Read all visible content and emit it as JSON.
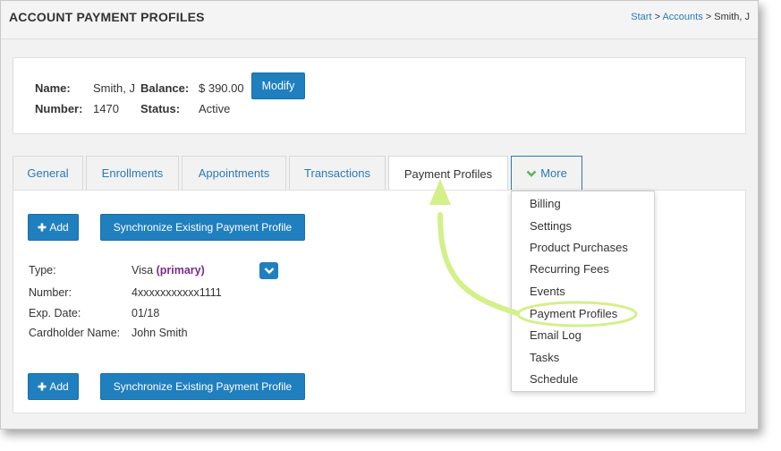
{
  "header": {
    "title": "ACCOUNT PAYMENT PROFILES",
    "breadcrumb": {
      "start": "Start",
      "sep1": ">",
      "accounts": "Accounts",
      "sep2": ">",
      "current": "Smith, J"
    }
  },
  "account": {
    "name_label": "Name:",
    "name_value": "Smith, J",
    "balance_label": "Balance:",
    "balance_value": "$ 390.00",
    "modify_label": "Modify",
    "number_label": "Number:",
    "number_value": "1470",
    "status_label": "Status:",
    "status_value": "Active"
  },
  "tabs": [
    {
      "label": "General"
    },
    {
      "label": "Enrollments"
    },
    {
      "label": "Appointments"
    },
    {
      "label": "Transactions"
    },
    {
      "label": "Payment Profiles"
    },
    {
      "label": "More"
    }
  ],
  "actions": {
    "add_label": "Add",
    "sync_label": "Synchronize Existing Payment Profile"
  },
  "profile": {
    "type_label": "Type:",
    "type_value": "Visa",
    "primary_tag": "(primary)",
    "number_label": "Number:",
    "number_value": "4xxxxxxxxxxx1111",
    "exp_label": "Exp. Date:",
    "exp_value": "01/18",
    "holder_label": "Cardholder Name:",
    "holder_value": "John Smith"
  },
  "more_menu": [
    "Billing",
    "Settings",
    "Product Purchases",
    "Recurring Fees",
    "Events",
    "Payment Profiles",
    "Email Log",
    "Tasks",
    "Schedule"
  ],
  "colors": {
    "accent": "#1f7fbf",
    "link": "#2a7ab8",
    "primary_tag": "#7b2a8c",
    "annotation": "#d4f08a"
  },
  "icons": {
    "add": "plus-icon",
    "more": "chevron-down-icon",
    "profile_menu": "chevron-down-icon"
  }
}
